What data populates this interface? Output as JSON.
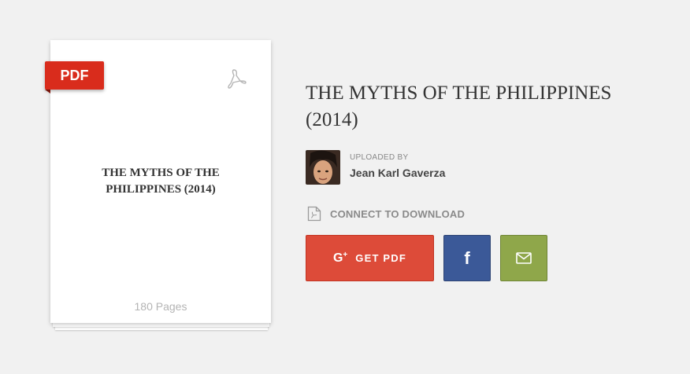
{
  "badge": {
    "label": "PDF"
  },
  "card": {
    "title_line1": "THE MYTHS OF THE",
    "title_line2": "PHILIPPINES (2014)",
    "pages": "180 Pages"
  },
  "document": {
    "title": "THE MYTHS OF THE PHILIPPINES (2014)"
  },
  "uploader": {
    "label": "UPLOADED BY",
    "name": "Jean Karl Gaverza"
  },
  "download": {
    "connect_label": "CONNECT TO DOWNLOAD",
    "google_label": "GET PDF",
    "google_glyph": "G+"
  },
  "icons": {
    "acrobat": "acrobat-icon",
    "pdf_file": "pdf-file-icon",
    "google_plus": "google-plus-icon",
    "facebook": "facebook-icon",
    "email": "envelope-icon"
  },
  "colors": {
    "badge": "#d92c1c",
    "google": "#dd4b39",
    "facebook": "#3b5998",
    "email": "#8fa74a"
  }
}
